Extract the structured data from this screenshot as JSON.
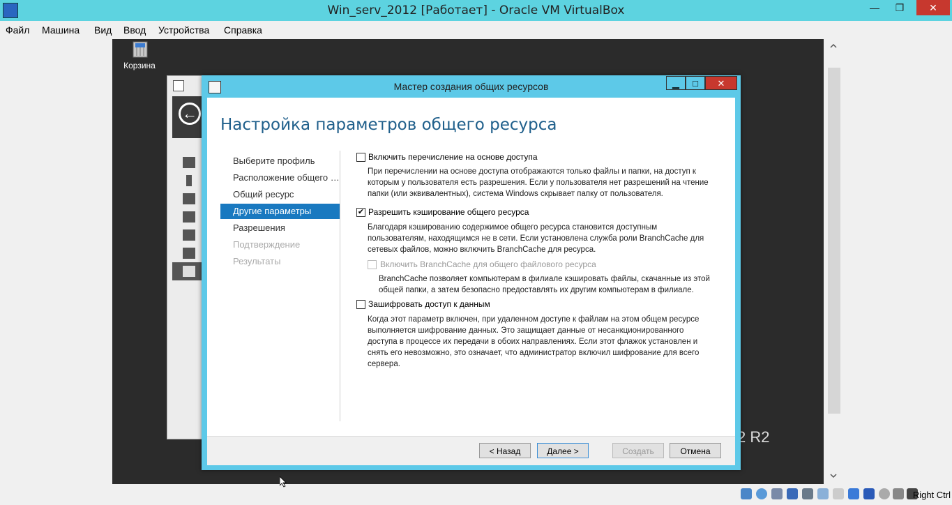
{
  "host": {
    "title": "Win_serv_2012 [Работает] - Oracle VM VirtualBox",
    "menu": [
      "Файл",
      "Машина",
      "Вид",
      "Ввод",
      "Устройства",
      "Справка"
    ],
    "min_glyph": "—",
    "max_glyph": "❐",
    "close_glyph": "✕",
    "right_ctrl": "Right Ctrl"
  },
  "desktop": {
    "recycle_label": "Корзина",
    "r2_label": "2 R2"
  },
  "dialog": {
    "title": "Мастер создания общих ресурсов",
    "heading": "Настройка параметров общего ресурса",
    "steps": [
      {
        "label": "Выберите профиль",
        "state": "normal"
      },
      {
        "label": "Расположение общего р...",
        "state": "normal"
      },
      {
        "label": "Общий ресурс",
        "state": "normal"
      },
      {
        "label": "Другие параметры",
        "state": "active"
      },
      {
        "label": "Разрешения",
        "state": "normal"
      },
      {
        "label": "Подтверждение",
        "state": "disabled"
      },
      {
        "label": "Результаты",
        "state": "disabled"
      }
    ],
    "options": {
      "abe": {
        "label": "Включить перечисление на основе доступа",
        "checked": false,
        "desc_lines": [
          "При перечислении на основе доступа отображаются только файлы и папки, на доступ к",
          "которым у пользователя есть разрешения. Если у пользователя нет разрешений на чтение",
          "папки (или эквивалентных), система Windows скрывает папку от пользователя."
        ]
      },
      "cache": {
        "label": "Разрешить кэширование общего ресурса",
        "checked": true,
        "check_glyph": "✔",
        "desc_lines": [
          "Благодаря кэшированию содержимое общего ресурса становится доступным",
          "пользователям, находящимся не в сети. Если установлена служба роли BranchCache для",
          "сетевых файлов, можно включить BranchCache для ресурса."
        ]
      },
      "branchcache": {
        "label": "Включить BranchCache для общего файлового ресурса",
        "checked": false,
        "disabled": true,
        "desc_lines": [
          "BranchCache позволяет компьютерам в филиале кэшировать файлы, скачанные из этой",
          "общей папки, а затем безопасно предоставлять их другим компьютерам в филиале."
        ]
      },
      "encrypt": {
        "label": "Зашифровать доступ к данным",
        "checked": false,
        "desc_lines": [
          "Когда этот параметр включен, при удаленном доступе к файлам на этом общем ресурсе",
          "выполняется шифрование данных. Это защищает данные от несанкционированного",
          "доступа в процессе их передачи в обоих направлениях. Если этот флажок установлен и",
          "снять его невозможно, это означает, что администратор включил шифрование для всего",
          "сервера."
        ]
      }
    },
    "buttons": {
      "back": "< Назад",
      "next": "Далее >",
      "create": "Создать",
      "cancel": "Отмена"
    }
  },
  "colors": {
    "titlebar": "#5dd3e0",
    "accent": "#1979c0",
    "close": "#c7382e"
  }
}
